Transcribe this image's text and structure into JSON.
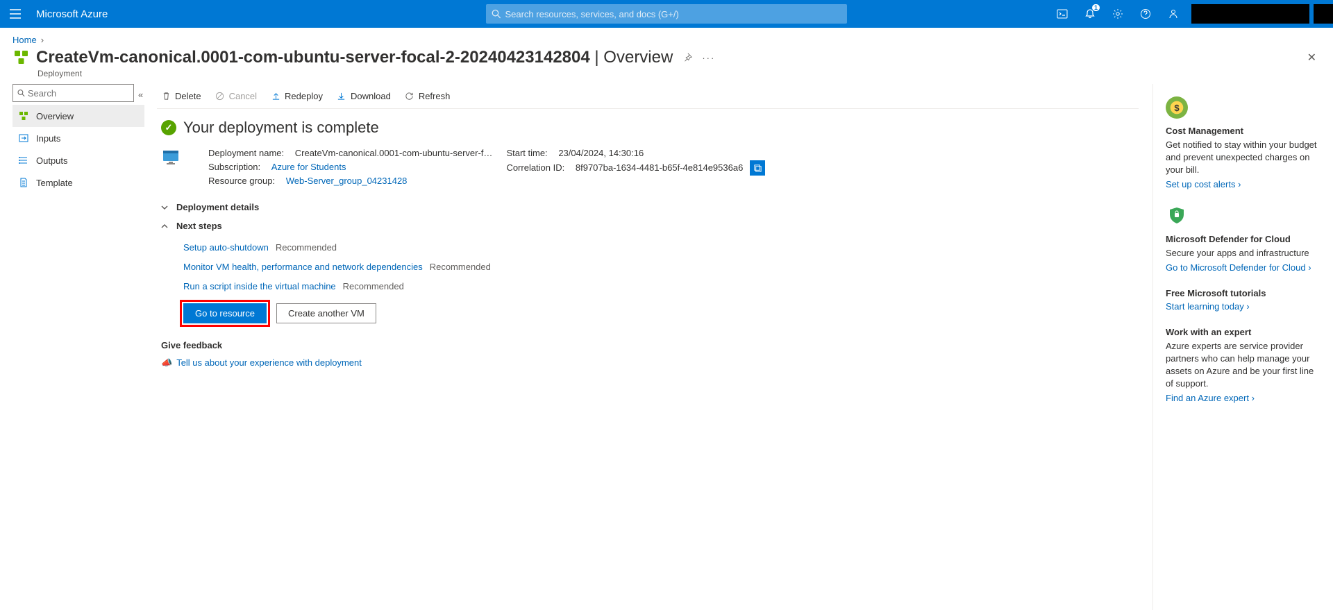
{
  "topbar": {
    "brand": "Microsoft Azure",
    "search_placeholder": "Search resources, services, and docs (G+/)",
    "notification_count": "1"
  },
  "breadcrumb": {
    "home": "Home"
  },
  "page": {
    "title": "CreateVm-canonical.0001-com-ubuntu-server-focal-2-20240423142804",
    "tab": "Overview",
    "subtype": "Deployment"
  },
  "leftnav": {
    "search_placeholder": "Search",
    "items": [
      {
        "label": "Overview"
      },
      {
        "label": "Inputs"
      },
      {
        "label": "Outputs"
      },
      {
        "label": "Template"
      }
    ]
  },
  "toolbar": {
    "delete": "Delete",
    "cancel": "Cancel",
    "redeploy": "Redeploy",
    "download": "Download",
    "refresh": "Refresh"
  },
  "status_heading": "Your deployment is complete",
  "details": {
    "deployment_label": "Deployment name:",
    "deployment_value": "CreateVm-canonical.0001-com-ubuntu-server-f…",
    "subscription_label": "Subscription:",
    "subscription_value": "Azure for Students",
    "rg_label": "Resource group:",
    "rg_value": "Web-Server_group_04231428",
    "start_label": "Start time:",
    "start_value": "23/04/2024, 14:30:16",
    "corr_label": "Correlation ID:",
    "corr_value": "8f9707ba-1634-4481-b65f-4e814e9536a6"
  },
  "sections": {
    "deployment_details": "Deployment details",
    "next_steps": "Next steps"
  },
  "next_steps": [
    {
      "link": "Setup auto-shutdown",
      "tag": "Recommended"
    },
    {
      "link": "Monitor VM health, performance and network dependencies",
      "tag": "Recommended"
    },
    {
      "link": "Run a script inside the virtual machine",
      "tag": "Recommended"
    }
  ],
  "buttons": {
    "go_to_resource": "Go to resource",
    "create_another": "Create another VM"
  },
  "feedback": {
    "heading": "Give feedback",
    "link": "Tell us about your experience with deployment"
  },
  "right": {
    "cost": {
      "title": "Cost Management",
      "text": "Get notified to stay within your budget and prevent unexpected charges on your bill.",
      "link": "Set up cost alerts"
    },
    "defender": {
      "title": "Microsoft Defender for Cloud",
      "text": "Secure your apps and infrastructure",
      "link": "Go to Microsoft Defender for Cloud"
    },
    "tutorials": {
      "title": "Free Microsoft tutorials",
      "link": "Start learning today"
    },
    "expert": {
      "title": "Work with an expert",
      "text": "Azure experts are service provider partners who can help manage your assets on Azure and be your first line of support.",
      "link": "Find an Azure expert"
    }
  }
}
